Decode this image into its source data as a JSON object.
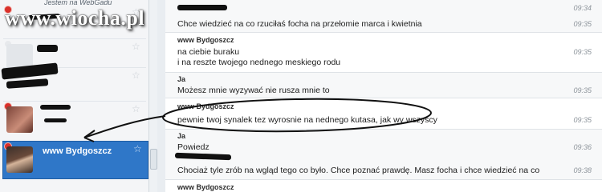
{
  "watermark": {
    "text": "www.wiocha.pl"
  },
  "sidebar": {
    "header_partial": "Jestem na WebGadu",
    "contacts": [
      {
        "label": "www Bydgoszcz",
        "selected": true
      }
    ],
    "accent_color": "#2f77c8"
  },
  "chat": {
    "messages": [
      {
        "sender": "",
        "lines": [
          "Chce wiedzieć na co rzuciłaś focha na przełomie marca i kwietnia"
        ],
        "times": [
          "09:34",
          "09:35"
        ]
      },
      {
        "sender": "www Bydgoszcz",
        "lines": [
          "na ciebie buraku",
          "i na reszte twojego nednego meskiego rodu"
        ],
        "times": [
          "09:35"
        ]
      },
      {
        "sender": "Ja",
        "lines": [
          "Możesz mnie wyzywać nie rusza mnie to"
        ],
        "times": [
          "09:35"
        ]
      },
      {
        "sender": "www Bydgoszcz",
        "lines": [
          "pewnie twoj synalek tez wyrosnie na nednego kutasa, jak wy wszyscy"
        ],
        "times": [
          "09:35"
        ]
      },
      {
        "sender": "Ja",
        "lines": [
          "Powiedz",
          "Chociaż tyle zrób na wgląd tego co było. Chce poznać prawdę. Masz focha i chce wiedzieć na co"
        ],
        "times": [
          "09:36",
          "09:38"
        ]
      },
      {
        "sender": "www Bydgoszcz",
        "lines": [],
        "times": []
      }
    ]
  }
}
